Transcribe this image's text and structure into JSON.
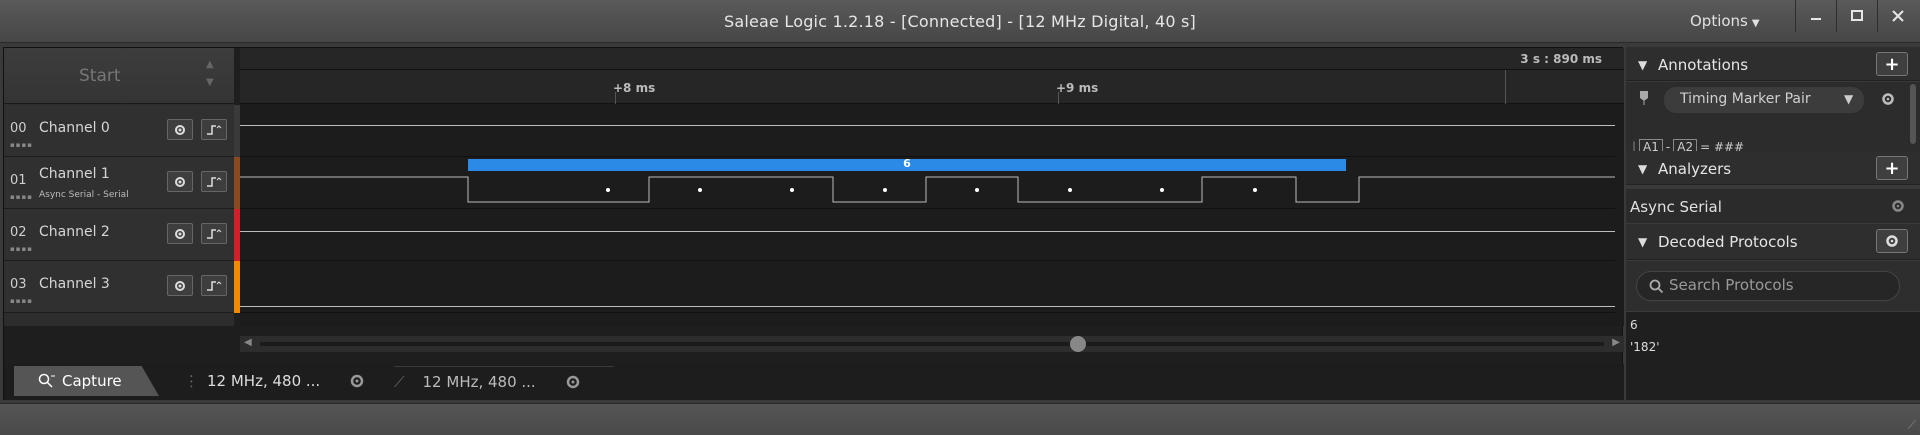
{
  "window": {
    "title": "Saleae Logic 1.2.18 - [Connected] - [12 MHz Digital, 40 s]",
    "options_label": "Options"
  },
  "start": {
    "label": "Start"
  },
  "ruler": {
    "time_readout": "3 s : 890 ms",
    "ticks": [
      "+8 ms",
      "+9 ms"
    ]
  },
  "channels": [
    {
      "num": "00",
      "name": "Channel 0",
      "sub": "",
      "color": "#3a3a3a"
    },
    {
      "num": "01",
      "name": "Channel 1",
      "sub": "Async Serial - Serial",
      "color": "#8a4a20"
    },
    {
      "num": "02",
      "name": "Channel 2",
      "sub": "",
      "color": "#d0202a"
    },
    {
      "num": "03",
      "name": "Channel 3",
      "sub": "",
      "color": "#f08a00"
    }
  ],
  "decode": {
    "value": "6"
  },
  "tabs": {
    "capture": "Capture",
    "session1": "12 MHz, 480 ...",
    "session2": "12 MHz, 480 ..."
  },
  "annotations": {
    "title": "Annotations",
    "marker_pair": "Timing Marker Pair",
    "formula_a1": "A1",
    "formula_a2": "A2",
    "formula_sep": "-",
    "formula_result": "= ###"
  },
  "analyzers": {
    "title": "Analyzers",
    "items": [
      "Async Serial"
    ]
  },
  "decoded": {
    "title": "Decoded Protocols",
    "search_placeholder": "Search Protocols",
    "results": [
      "6",
      "'182'"
    ]
  },
  "colors": {
    "decode_bar": "#2b8ae6",
    "background": "#1e1e1e"
  }
}
